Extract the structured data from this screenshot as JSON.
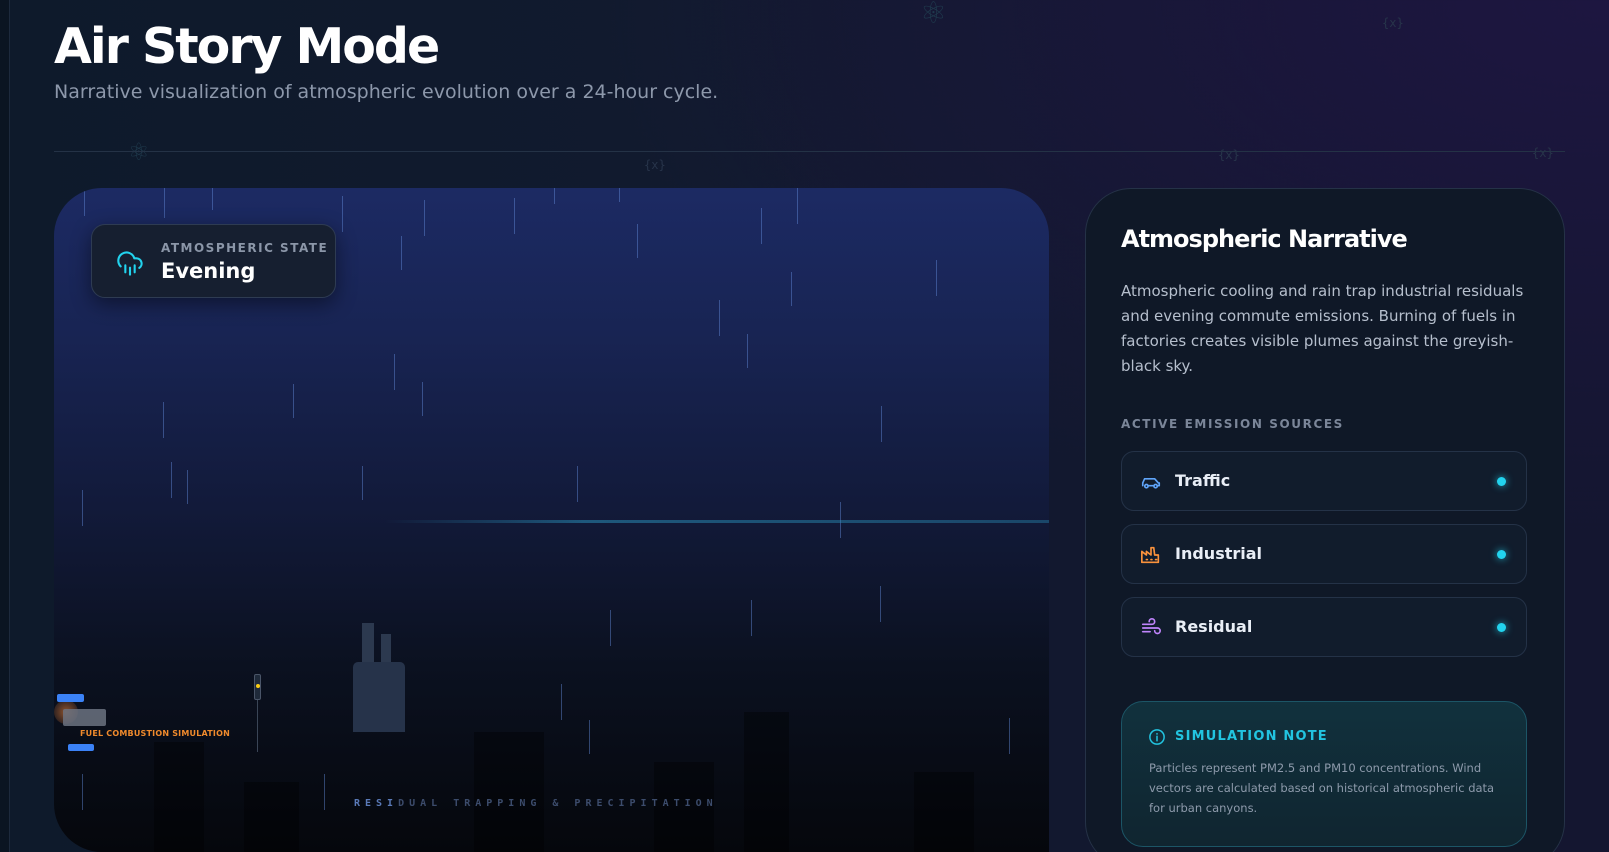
{
  "header": {
    "title": "Air Story Mode",
    "subtitle": "Narrative visualization of atmospheric evolution over a 24-hour cycle."
  },
  "scene": {
    "state_label": "ATMOSPHERIC STATE",
    "state_value": "Evening",
    "state_icon": "cloud-rain-icon",
    "fuel_label": "FUEL COMBUSTION SIMULATION",
    "caption_highlight": "RESI",
    "caption_rest": "DUAL TRAPPING & PRECIPITATION"
  },
  "panel": {
    "title": "Atmospheric Narrative",
    "description": "Atmospheric cooling and rain trap industrial residuals and evening commute emissions. Burning of fuels in factories creates visible plumes against the greyish-black sky.",
    "sources_heading": "ACTIVE EMISSION SOURCES",
    "sources": [
      {
        "label": "Traffic",
        "icon": "car-icon",
        "color": "#60a5fa"
      },
      {
        "label": "Industrial",
        "icon": "factory-icon",
        "color": "#fb923c"
      },
      {
        "label": "Residual",
        "icon": "wind-icon",
        "color": "#c084fc"
      }
    ],
    "note": {
      "title": "SIMULATION NOTE",
      "body": "Particles represent PM2.5 and PM10 concentrations. Wind vectors are calculated based on historical atmospheric data for urban canyons."
    }
  },
  "colors": {
    "accent": "#22d3ee",
    "traffic": "#60a5fa",
    "industrial": "#fb923c",
    "residual": "#c084fc"
  }
}
